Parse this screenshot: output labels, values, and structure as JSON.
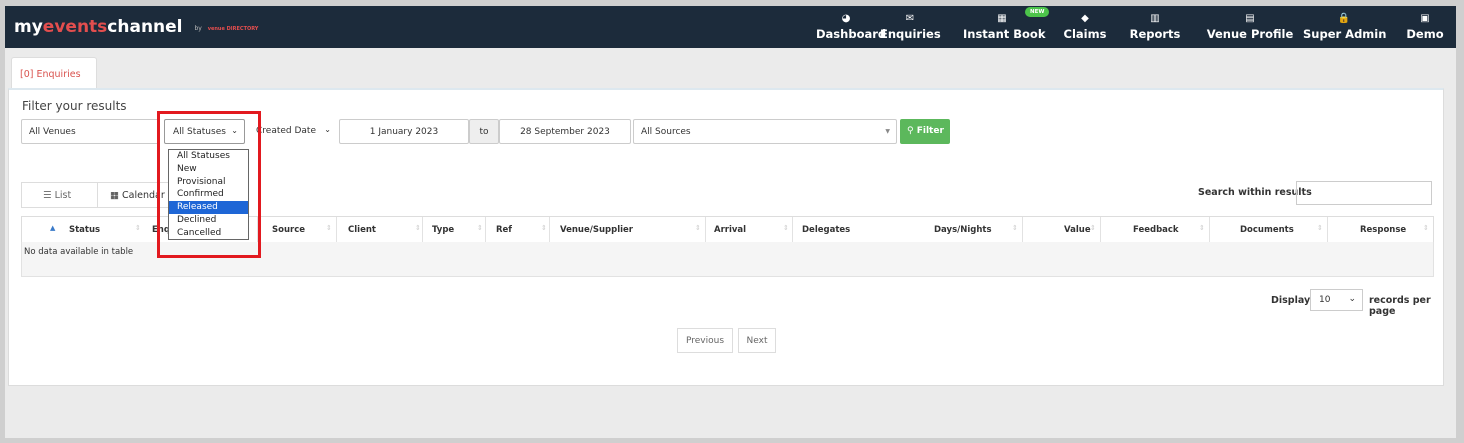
{
  "brand": {
    "pre": "my",
    "accent": "events",
    "post": "channel",
    "by": "by",
    "vd": "venue DIRECTORY"
  },
  "nav": [
    {
      "label": "Dashboard",
      "icon": "◕"
    },
    {
      "label": "Enquiries",
      "icon": "✉"
    },
    {
      "label": "Instant Book",
      "icon": "▦"
    },
    {
      "label": "Claims",
      "icon": "◆"
    },
    {
      "label": "Reports",
      "icon": "▥"
    },
    {
      "label": "Venue Profile",
      "icon": "▤"
    },
    {
      "label": "Super Admin",
      "icon": "🔒"
    },
    {
      "label": "Demo",
      "icon": "▣"
    }
  ],
  "new_badge": "NEW",
  "tab": "[0] Enquiries",
  "filter": {
    "title": "Filter your results",
    "venue": "All Venues",
    "status": "All Statuses",
    "date_type": "Created Date",
    "date_from": "1 January 2023",
    "to": "to",
    "date_to": "28 September 2023",
    "source": "All Sources",
    "button": "Filter"
  },
  "status_options": [
    "All Statuses",
    "New",
    "Provisional",
    "Confirmed",
    "Released",
    "Declined",
    "Cancelled"
  ],
  "status_selected": "Released",
  "view": {
    "list": "List",
    "calendar": "Calendar"
  },
  "search_label": "Search within results",
  "table": {
    "columns": [
      "Status",
      "Enq",
      "Source",
      "Client",
      "Type",
      "Ref",
      "Venue/Supplier",
      "Arrival",
      "Delegates",
      "Days/Nights",
      "Value",
      "Feedback",
      "Documents",
      "Response"
    ],
    "empty": "No data available in table"
  },
  "pagination": {
    "display": "Display",
    "per_page": "10",
    "records": "records per page",
    "previous": "Previous",
    "next": "Next"
  }
}
